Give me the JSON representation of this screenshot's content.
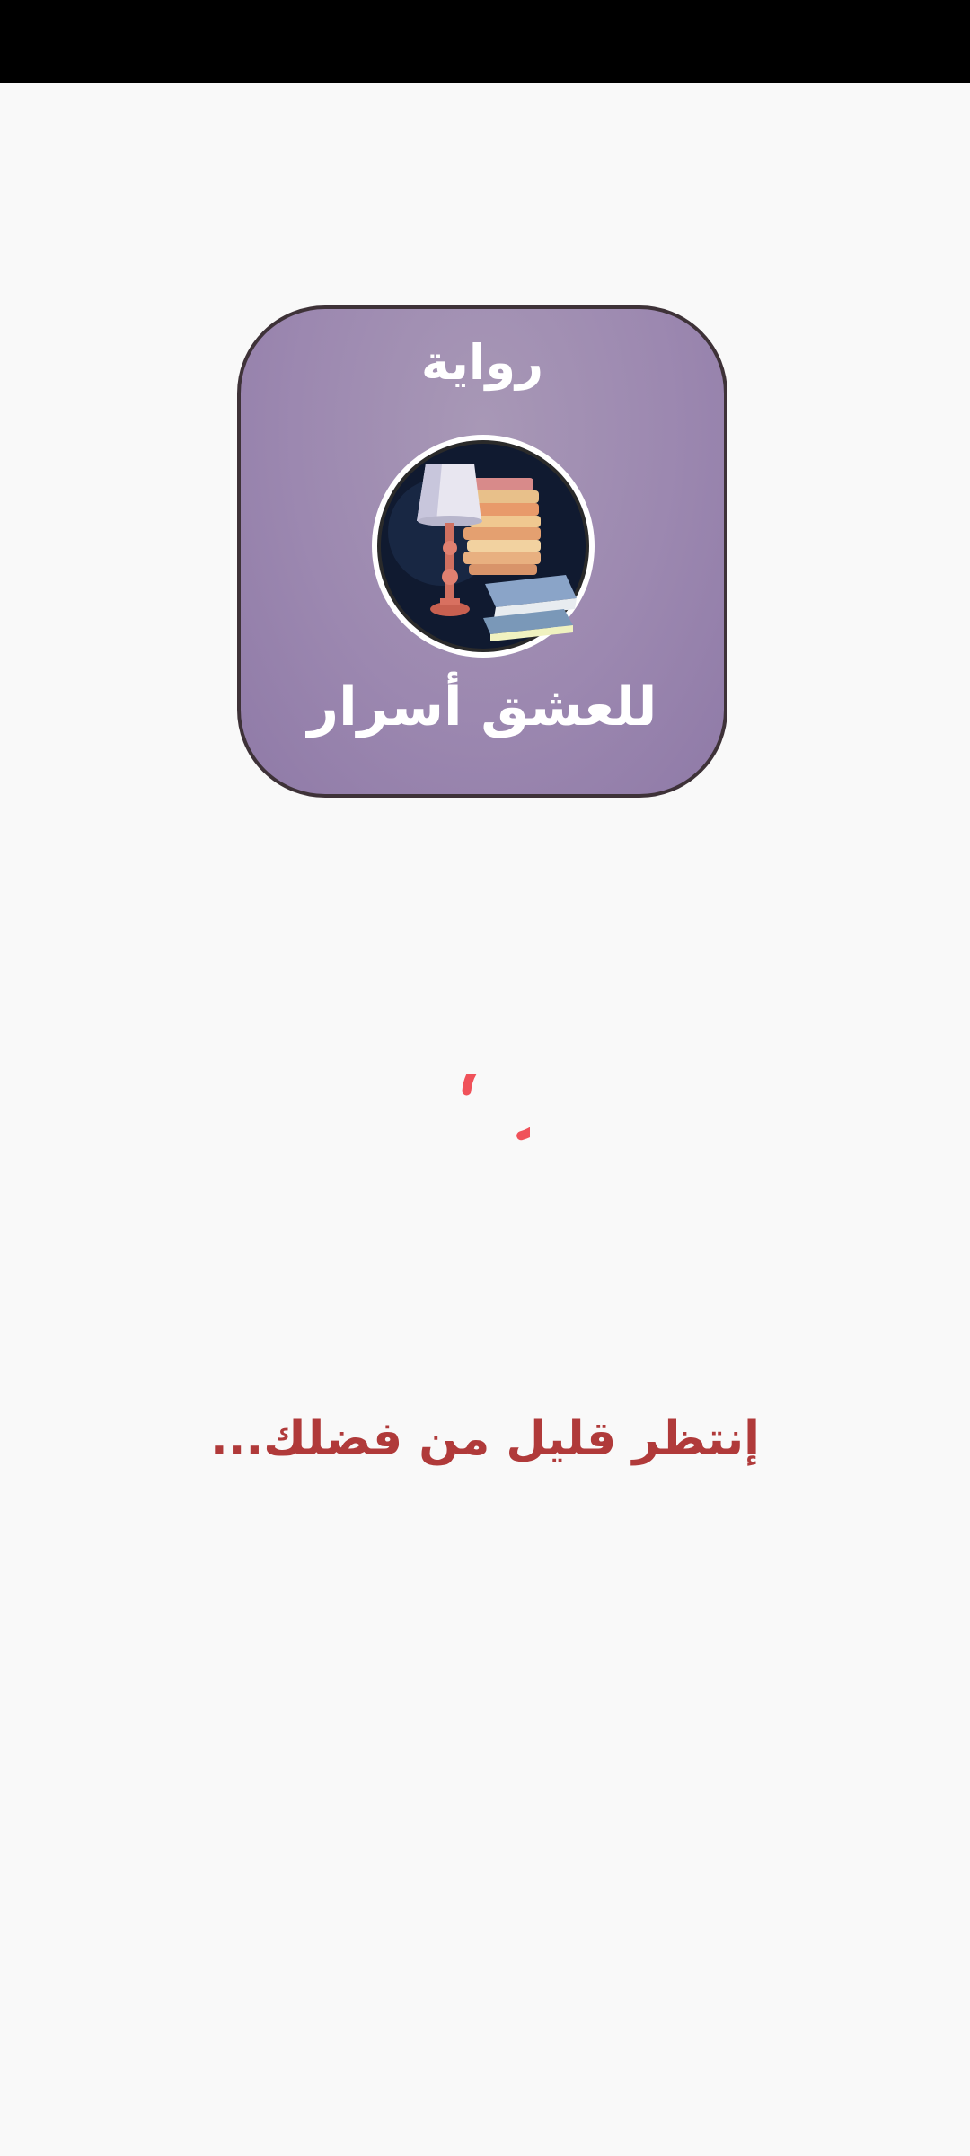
{
  "app_icon": {
    "title_top": "رواية",
    "title_bottom": "للعشق أسرار",
    "emblem_icon": "lamp-and-books-icon",
    "background_color": "#9c88b0"
  },
  "spinner": {
    "icon": "loading-spinner-icon",
    "color": "#f0525a"
  },
  "loading_message": "إنتظر قليل من فضلك..."
}
